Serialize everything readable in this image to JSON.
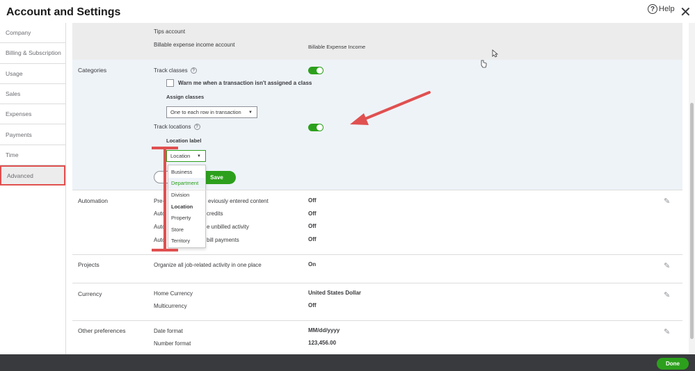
{
  "header": {
    "title": "Account and Settings",
    "help_label": "Help",
    "help_glyph": "?",
    "close_glyph": "✕"
  },
  "sidebar": {
    "items": [
      {
        "label": "Company"
      },
      {
        "label": "Billing & Subscription"
      },
      {
        "label": "Usage"
      },
      {
        "label": "Sales"
      },
      {
        "label": "Expenses"
      },
      {
        "label": "Payments"
      },
      {
        "label": "Time"
      },
      {
        "label": "Advanced"
      }
    ],
    "active_index": 7
  },
  "expenses_top": {
    "tips_account": "Tips account",
    "billable_label": "Billable expense income account",
    "billable_value": "Billable Expense Income"
  },
  "categories": {
    "title": "Categories",
    "track_classes": "Track classes",
    "warn_label": "Warn me when a transaction isn't assigned a class",
    "assign_label": "Assign classes",
    "assign_value": "One to each row in transaction",
    "track_locations": "Track locations",
    "location_label_title": "Location label",
    "location_value": "Location",
    "save_label": "Save",
    "dropdown": {
      "options": [
        "Business",
        "Department",
        "Division",
        "Location",
        "Property",
        "Store",
        "Territory"
      ],
      "highlighted": "Department",
      "selected": "Location"
    }
  },
  "automation": {
    "title": "Automation",
    "rows": [
      {
        "label": "Pre-",
        "label_tail": "eviously entered content",
        "value": "Off"
      },
      {
        "label": "Auto",
        "label_tail": "credits",
        "value": "Off"
      },
      {
        "label": "Auto",
        "label_tail": "e unbilled activity",
        "value": "Off"
      },
      {
        "label": "Auto",
        "label_tail": "bill payments",
        "value": "Off"
      }
    ]
  },
  "projects": {
    "title": "Projects",
    "label": "Organize all job-related activity in one place",
    "value": "On"
  },
  "currency": {
    "title": "Currency",
    "rows": [
      {
        "label": "Home Currency",
        "value": "United States Dollar"
      },
      {
        "label": "Multicurrency",
        "value": "Off"
      }
    ]
  },
  "other": {
    "title": "Other preferences",
    "rows": [
      {
        "label": "Date format",
        "value": "MM/dd/yyyy"
      },
      {
        "label": "Number format",
        "value": "123,456.00"
      }
    ]
  },
  "footer": {
    "done_label": "Done"
  },
  "colors": {
    "accent": "#2ca01c",
    "annotation": "#e05050",
    "footer_bg": "#393a3d"
  },
  "icons": {
    "pencil": "✎",
    "caret": "▼",
    "qmark": "?"
  }
}
